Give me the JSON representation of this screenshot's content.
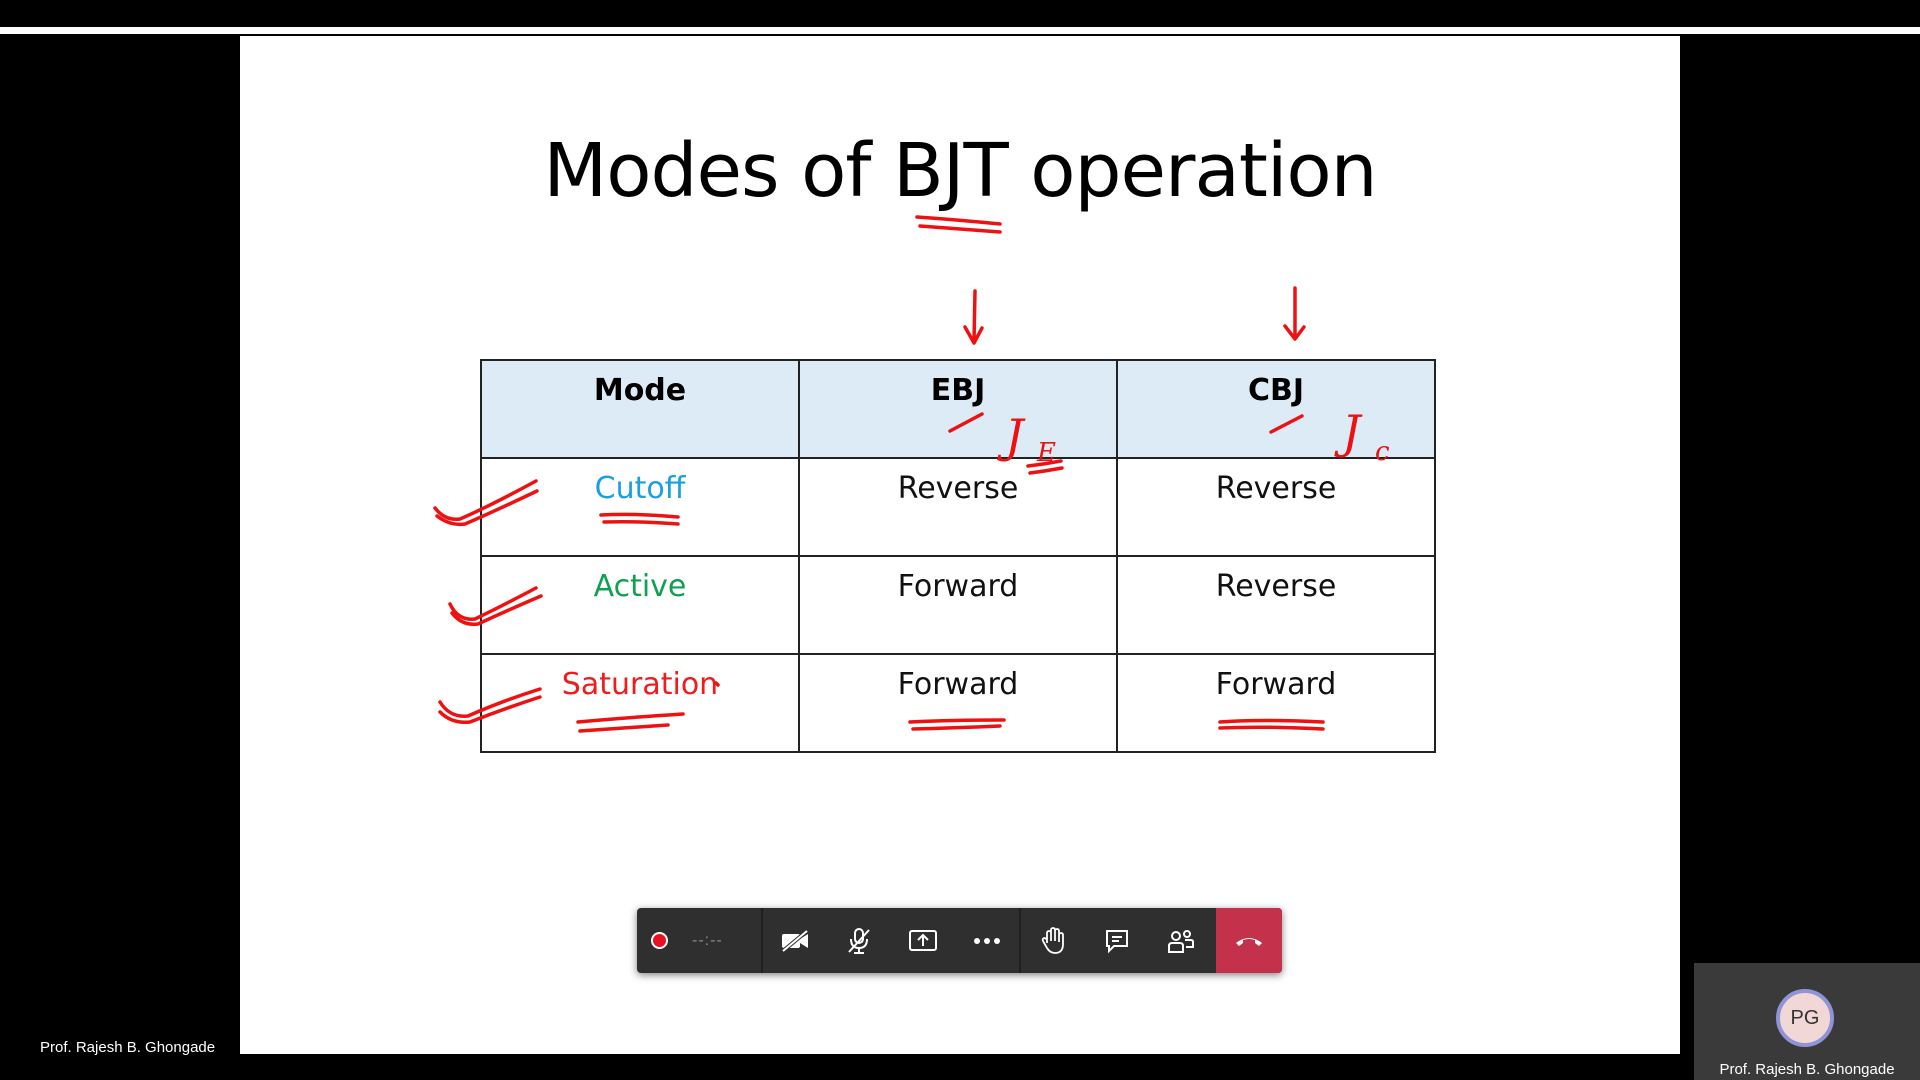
{
  "slide": {
    "title": "Modes of BJT operation",
    "table": {
      "headers": [
        "Mode",
        "EBJ",
        "CBJ"
      ],
      "rows": [
        {
          "mode": "Cutoff",
          "ebj": "Reverse",
          "cbj": "Reverse",
          "mode_color": "#1aa0e0"
        },
        {
          "mode": "Active",
          "ebj": "Forward",
          "cbj": "Reverse",
          "mode_color": "#10a050"
        },
        {
          "mode": "Saturation",
          "ebj": "Forward",
          "cbj": "Forward",
          "mode_color": "#ee1c1c"
        }
      ],
      "header_bg": "#ddebf7"
    },
    "annotations": {
      "ink_color": "#ee1111",
      "ebj_note": "J",
      "ebj_note_sub": "E",
      "cbj_note": "J",
      "cbj_note_sub": "c"
    }
  },
  "toolbar": {
    "timer": "--:--",
    "buttons": [
      "record",
      "camera-off",
      "mic-muted",
      "share",
      "more",
      "raise-hand",
      "chat",
      "participants",
      "hang-up"
    ],
    "hangup_color": "#c4314b"
  },
  "presenter": {
    "name": "Prof. Rajesh B. Ghongade"
  },
  "self_view": {
    "initials": "PG",
    "name": "Prof. Rajesh B. Ghongade"
  }
}
